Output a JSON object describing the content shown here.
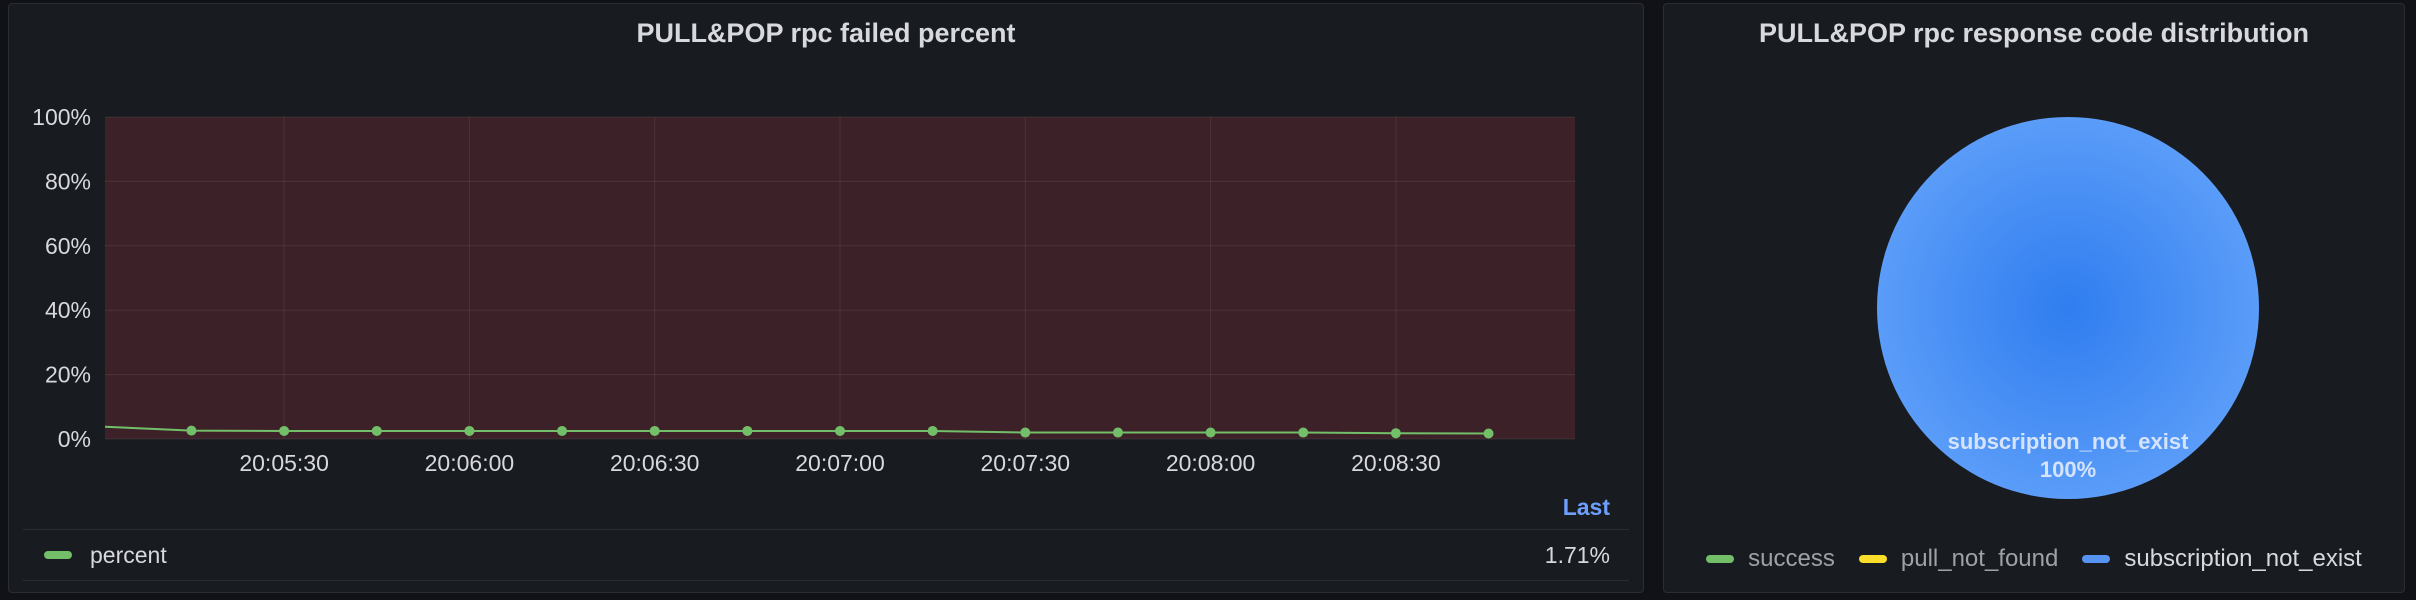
{
  "chart_data": [
    {
      "type": "line",
      "title": "PULL&POP rpc failed percent",
      "x": [
        "20:05:05",
        "20:05:15",
        "20:05:30",
        "20:05:45",
        "20:06:00",
        "20:06:15",
        "20:06:30",
        "20:06:45",
        "20:07:00",
        "20:07:15",
        "20:07:30",
        "20:07:45",
        "20:08:00",
        "20:08:15",
        "20:08:30",
        "20:08:45"
      ],
      "x_ticks": [
        "20:05:30",
        "20:06:00",
        "20:06:30",
        "20:07:00",
        "20:07:30",
        "20:08:00",
        "20:08:30"
      ],
      "y_ticks": [
        "100%",
        "80%",
        "60%",
        "40%",
        "20%",
        "0%"
      ],
      "ylim": [
        0,
        100
      ],
      "grid": true,
      "series": [
        {
          "name": "percent",
          "color": "#73bf69",
          "values": [
            3.8,
            2.6,
            2.5,
            2.5,
            2.5,
            2.5,
            2.5,
            2.5,
            2.5,
            2.5,
            2.0,
            2.0,
            2.0,
            2.0,
            1.8,
            1.71
          ]
        }
      ],
      "legend": {
        "placement": "bottom",
        "header": "Last",
        "items": [
          {
            "name": "percent",
            "value": "1.71%",
            "color": "#73bf69"
          }
        ]
      }
    },
    {
      "type": "pie",
      "title": "PULL&POP rpc response code distribution",
      "slices": [
        {
          "name": "success",
          "value": 0,
          "color": "#73bf69"
        },
        {
          "name": "pull_not_found",
          "value": 0,
          "color": "#fade2a"
        },
        {
          "name": "subscription_not_exist",
          "value": 100,
          "color": "#5794f2"
        }
      ],
      "label": {
        "name": "subscription_not_exist",
        "percent": "100%"
      },
      "legend": {
        "placement": "bottom"
      }
    }
  ]
}
